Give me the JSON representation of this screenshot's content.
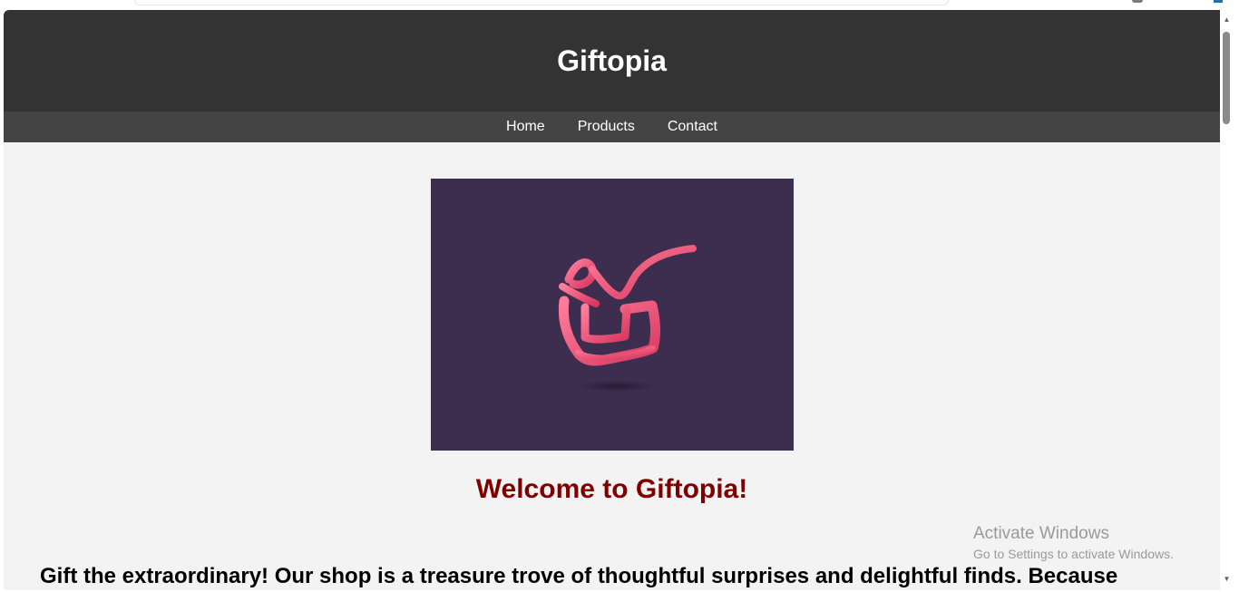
{
  "site": {
    "title": "Giftopia",
    "nav": [
      {
        "label": "Home"
      },
      {
        "label": "Products"
      },
      {
        "label": "Contact"
      }
    ],
    "welcome_heading": "Welcome to Giftopia!",
    "intro_text": "Gift the extraordinary! Our shop is a treasure trove of thoughtful surprises and delightful finds. Because"
  },
  "watermark": {
    "title": "Activate Windows",
    "subtitle": "Go to Settings to activate Windows."
  },
  "colors": {
    "header": "#333333",
    "nav": "#444444",
    "page_background": "#f3f3f3",
    "heading": "#800000",
    "hero_background": "#3d2d4f",
    "ribbon": "#f0527c"
  },
  "icons": {
    "hero": "gift-ribbon-logo",
    "scroll_up": "scroll-up-arrow-icon",
    "scroll_down": "scroll-down-arrow-icon"
  }
}
